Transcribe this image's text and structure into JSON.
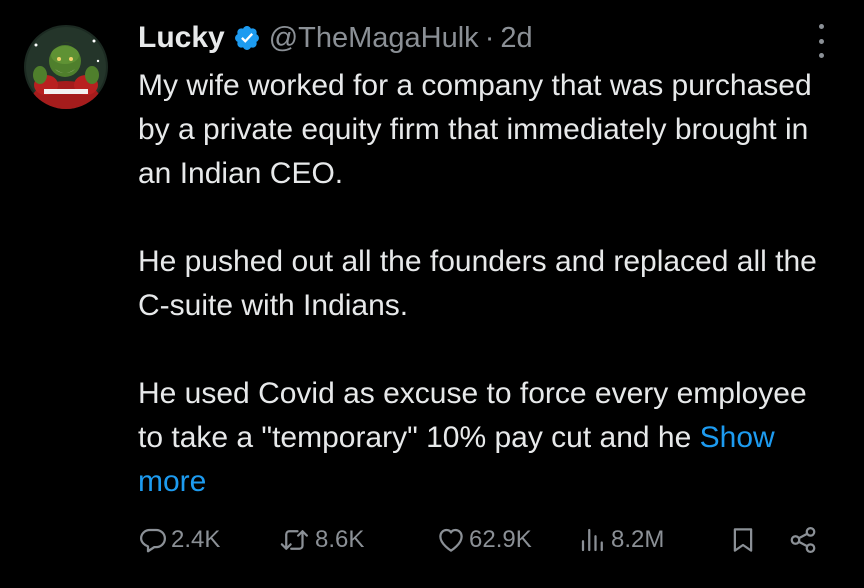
{
  "author": {
    "display_name": "Lucky",
    "handle": "@TheMagaHulk",
    "separator": "·",
    "time": "2d",
    "verified_color": "#1d9bf0"
  },
  "tweet": {
    "paragraphs": [
      "My wife worked for a company that was purchased by a private equity firm that immediately brought in an Indian CEO.",
      "He pushed out all the founders and replaced all the C-suite with Indians."
    ],
    "last_paragraph": "He used Covid as excuse to force every employee to take a \"temporary\" 10% pay cut and he",
    "show_more_label": "Show more",
    "link_color": "#1d9bf0"
  },
  "actions": {
    "replies": "2.4K",
    "reposts": "8.6K",
    "likes": "62.9K",
    "views": "8.2M",
    "icons": [
      "reply-icon",
      "repost-icon",
      "like-icon",
      "views-icon",
      "bookmark-icon",
      "share-icon"
    ]
  }
}
